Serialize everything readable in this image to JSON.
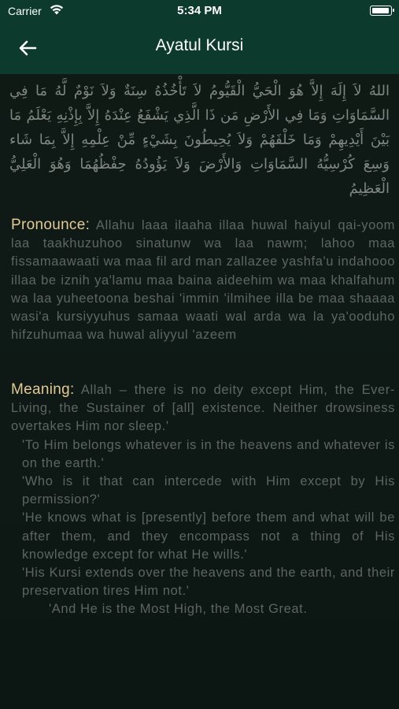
{
  "status_bar": {
    "carrier": "Carrier",
    "time": "5:34 PM",
    "icons": [
      "wifi-icon",
      "battery-icon"
    ]
  },
  "nav": {
    "title": "Ayatul Kursi",
    "back_icon": "arrow-left-icon"
  },
  "content": {
    "arabic": "اللهُ لاَ إِلَهَ إِلاَّ هُوَ الْحَيُّ الْقَيُّومُ لاَ تَأْخُذُهُ سِنَةٌ وَلاَ نَوْمٌ لَّهُ مَا فِي السَّمَاوَاتِ وَمَا فِي الأَرْضِ مَن ذَا الَّذِي يَشْفَعُ عِنْدَهُ إِلاَّ بِإِذْنِهِ يَعْلَمُ مَا بَيْنَ أَيْدِيهِمْ وَمَا خَلْفَهُمْ وَلاَ يُحِيطُونَ بِشَيْءٍ مِّنْ عِلْمِهِ إِلاَّ بِمَا شَاء وَسِعَ كُرْسِيُّهُ السَّمَاوَاتِ وَالأَرْضَ وَلاَ يَؤُودُهُ حِفْظُهُمَا وَهُوَ الْعَلِيُّ الْعَظِيمُ",
    "pronounce_label": "Pronounce:",
    "pronounce_text": "Allahu laaa ilaaha illaa huwal haiyul qai-yoom laa taakhuzuhoo sinatunw wa laa nawm; lahoo maa fissamaawaati wa maa fil ard man zallazee yashfa'u indahooo illaa be iznih ya'lamu maa baina aideehim wa maa khalfahum wa laa yuheetoona beshai 'immin 'ilmihee illa be maa shaaaa wasi'a kursiyyuhus samaa waati wal arda wa la ya'ooduho hifzuhumaa wa huwal aliyyul 'azeem",
    "meaning_label": "Meaning:",
    "meaning_lines": [
      "Allah – there is no deity except Him, the Ever-Living, the Sustainer of [all] existence. Neither drowsiness overtakes Him nor sleep.'",
      "'To Him belongs whatever is in the heavens and whatever is on the earth.'",
      "'Who is it that can intercede with Him except by His permission?'",
      "'He knows what is [presently] before them and what will be after them, and they encompass not a thing of His knowledge except for what He wills.'",
      "'His Kursi extends over the heavens and the earth, and their preservation tires Him not.'",
      "'And He is the Most High, the Most Great."
    ]
  },
  "colors": {
    "nav_background": "#0c3a2c",
    "page_background": "#0f1a15",
    "label_color": "#e2ca93",
    "body_text": "#5e6561"
  }
}
